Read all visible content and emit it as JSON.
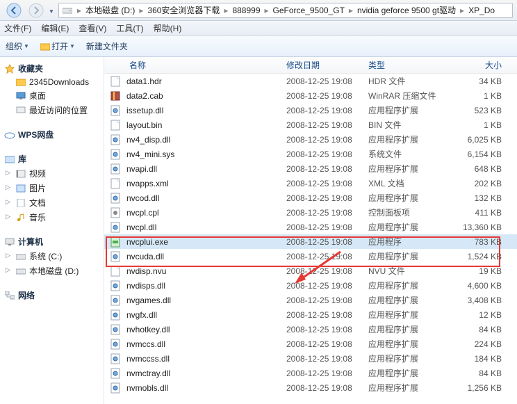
{
  "breadcrumb": [
    "本地磁盘 (D:)",
    "360安全浏览器下载",
    "888999",
    "GeForce_9500_GT",
    "nvidia geforce 9500 gt驱动",
    "XP_Do"
  ],
  "menu": {
    "file": "文件(F)",
    "edit": "编辑(E)",
    "view": "查看(V)",
    "tools": "工具(T)",
    "help": "帮助(H)"
  },
  "toolbar": {
    "organize": "组织",
    "open": "打开",
    "newfolder": "新建文件夹"
  },
  "cols": {
    "name": "名称",
    "date": "修改日期",
    "type": "类型",
    "size": "大小"
  },
  "sidebar": {
    "fav": {
      "head": "收藏夹",
      "items": [
        {
          "label": "2345Downloads",
          "icon": "folder"
        },
        {
          "label": "桌面",
          "icon": "desktop"
        },
        {
          "label": "最近访问的位置",
          "icon": "recent"
        }
      ]
    },
    "wps": {
      "head": "WPS网盘"
    },
    "lib": {
      "head": "库",
      "items": [
        {
          "label": "视频",
          "icon": "video",
          "expandable": true
        },
        {
          "label": "图片",
          "icon": "pic",
          "expandable": true
        },
        {
          "label": "文档",
          "icon": "doc",
          "expandable": true
        },
        {
          "label": "音乐",
          "icon": "music",
          "expandable": true
        }
      ]
    },
    "pc": {
      "head": "计算机",
      "items": [
        {
          "label": "系统 (C:)",
          "icon": "drive",
          "expandable": true
        },
        {
          "label": "本地磁盘 (D:)",
          "icon": "drive",
          "expandable": true
        }
      ]
    },
    "net": {
      "head": "网络"
    }
  },
  "files": [
    {
      "name": "data1.hdr",
      "date": "2008-12-25 19:08",
      "type": "HDR 文件",
      "size": "34 KB",
      "icon": "file"
    },
    {
      "name": "data2.cab",
      "date": "2008-12-25 19:08",
      "type": "WinRAR 压缩文件",
      "size": "1 KB",
      "icon": "archive"
    },
    {
      "name": "issetup.dll",
      "date": "2008-12-25 19:08",
      "type": "应用程序扩展",
      "size": "523 KB",
      "icon": "dll"
    },
    {
      "name": "layout.bin",
      "date": "2008-12-25 19:08",
      "type": "BIN 文件",
      "size": "1 KB",
      "icon": "file"
    },
    {
      "name": "nv4_disp.dll",
      "date": "2008-12-25 19:08",
      "type": "应用程序扩展",
      "size": "6,025 KB",
      "icon": "dll"
    },
    {
      "name": "nv4_mini.sys",
      "date": "2008-12-25 19:08",
      "type": "系统文件",
      "size": "6,154 KB",
      "icon": "dll"
    },
    {
      "name": "nvapi.dll",
      "date": "2008-12-25 19:08",
      "type": "应用程序扩展",
      "size": "648 KB",
      "icon": "dll"
    },
    {
      "name": "nvapps.xml",
      "date": "2008-12-25 19:08",
      "type": "XML 文档",
      "size": "202 KB",
      "icon": "file"
    },
    {
      "name": "nvcod.dll",
      "date": "2008-12-25 19:08",
      "type": "应用程序扩展",
      "size": "132 KB",
      "icon": "dll"
    },
    {
      "name": "nvcpl.cpl",
      "date": "2008-12-25 19:08",
      "type": "控制面板项",
      "size": "411 KB",
      "icon": "cpl"
    },
    {
      "name": "nvcpl.dll",
      "date": "2008-12-25 19:08",
      "type": "应用程序扩展",
      "size": "13,360 KB",
      "icon": "dll"
    },
    {
      "name": "nvcplui.exe",
      "date": "2008-12-25 19:08",
      "type": "应用程序",
      "size": "783 KB",
      "icon": "exe",
      "selected": true
    },
    {
      "name": "nvcuda.dll",
      "date": "2008-12-25 19:08",
      "type": "应用程序扩展",
      "size": "1,524 KB",
      "icon": "dll"
    },
    {
      "name": "nvdisp.nvu",
      "date": "2008-12-25 19:08",
      "type": "NVU 文件",
      "size": "19 KB",
      "icon": "file"
    },
    {
      "name": "nvdisps.dll",
      "date": "2008-12-25 19:08",
      "type": "应用程序扩展",
      "size": "4,600 KB",
      "icon": "dll"
    },
    {
      "name": "nvgames.dll",
      "date": "2008-12-25 19:08",
      "type": "应用程序扩展",
      "size": "3,408 KB",
      "icon": "dll"
    },
    {
      "name": "nvgfx.dll",
      "date": "2008-12-25 19:08",
      "type": "应用程序扩展",
      "size": "12 KB",
      "icon": "dll"
    },
    {
      "name": "nvhotkey.dll",
      "date": "2008-12-25 19:08",
      "type": "应用程序扩展",
      "size": "84 KB",
      "icon": "dll"
    },
    {
      "name": "nvmccs.dll",
      "date": "2008-12-25 19:08",
      "type": "应用程序扩展",
      "size": "224 KB",
      "icon": "dll"
    },
    {
      "name": "nvmccss.dll",
      "date": "2008-12-25 19:08",
      "type": "应用程序扩展",
      "size": "184 KB",
      "icon": "dll"
    },
    {
      "name": "nvmctray.dll",
      "date": "2008-12-25 19:08",
      "type": "应用程序扩展",
      "size": "84 KB",
      "icon": "dll"
    },
    {
      "name": "nvmobls.dll",
      "date": "2008-12-25 19:08",
      "type": "应用程序扩展",
      "size": "1,256 KB",
      "icon": "dll"
    }
  ]
}
